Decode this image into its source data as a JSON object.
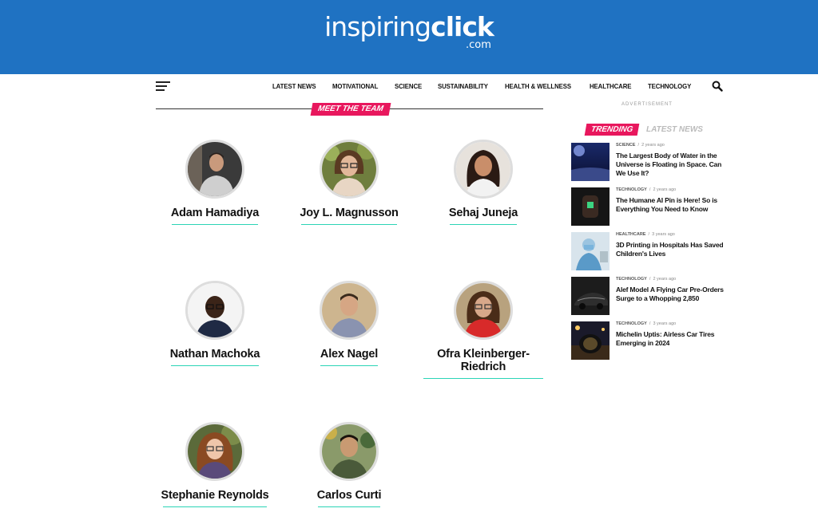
{
  "site": {
    "logo_regular": "inspiring",
    "logo_bold": "click",
    "logo_suffix": ".com",
    "brand_color": "#1f72c2",
    "accent_color": "#e8175d",
    "underline_color": "#2bd4b6"
  },
  "nav": {
    "menu_icon": "hamburger-menu-icon",
    "search_icon": "search-icon",
    "links": [
      "LATEST NEWS",
      "MOTIVATIONAL",
      "SCIENCE",
      "SUSTAINABILITY",
      "HEALTH & WELLNESS",
      "HEALTHCARE",
      "TECHNOLOGY"
    ]
  },
  "main": {
    "section_title": "MEET THE TEAM",
    "team": [
      {
        "name": "Adam Hamadiya"
      },
      {
        "name": "Joy L. Magnusson"
      },
      {
        "name": "Sehaj Juneja"
      },
      {
        "name": "Nathan Machoka"
      },
      {
        "name": "Alex Nagel"
      },
      {
        "name": "Ofra Kleinberger-Riedrich"
      },
      {
        "name": "Stephanie Reynolds"
      },
      {
        "name": "Carlos Curti"
      }
    ]
  },
  "sidebar": {
    "ad_label": "ADVERTISEMENT",
    "tab_trending": "TRENDING",
    "tab_latest": "LATEST NEWS",
    "articles": [
      {
        "category": "SCIENCE",
        "time": "2 years ago",
        "title": "The Largest Body of Water in the Universe is Floating in Space. Can We Use It?"
      },
      {
        "category": "TECHNOLOGY",
        "time": "2 years ago",
        "title": "The Humane AI Pin is Here! So is Everything You Need to Know"
      },
      {
        "category": "HEALTHCARE",
        "time": "3 years ago",
        "title": "3D Printing in Hospitals Has Saved Children's Lives"
      },
      {
        "category": "TECHNOLOGY",
        "time": "2 years ago",
        "title": "Alef Model A Flying Car Pre-Orders Surge to a Whopping 2,850"
      },
      {
        "category": "TECHNOLOGY",
        "time": "3 years ago",
        "title": "Michelin Uptis: Airless Car Tires Emerging in 2024"
      }
    ]
  }
}
